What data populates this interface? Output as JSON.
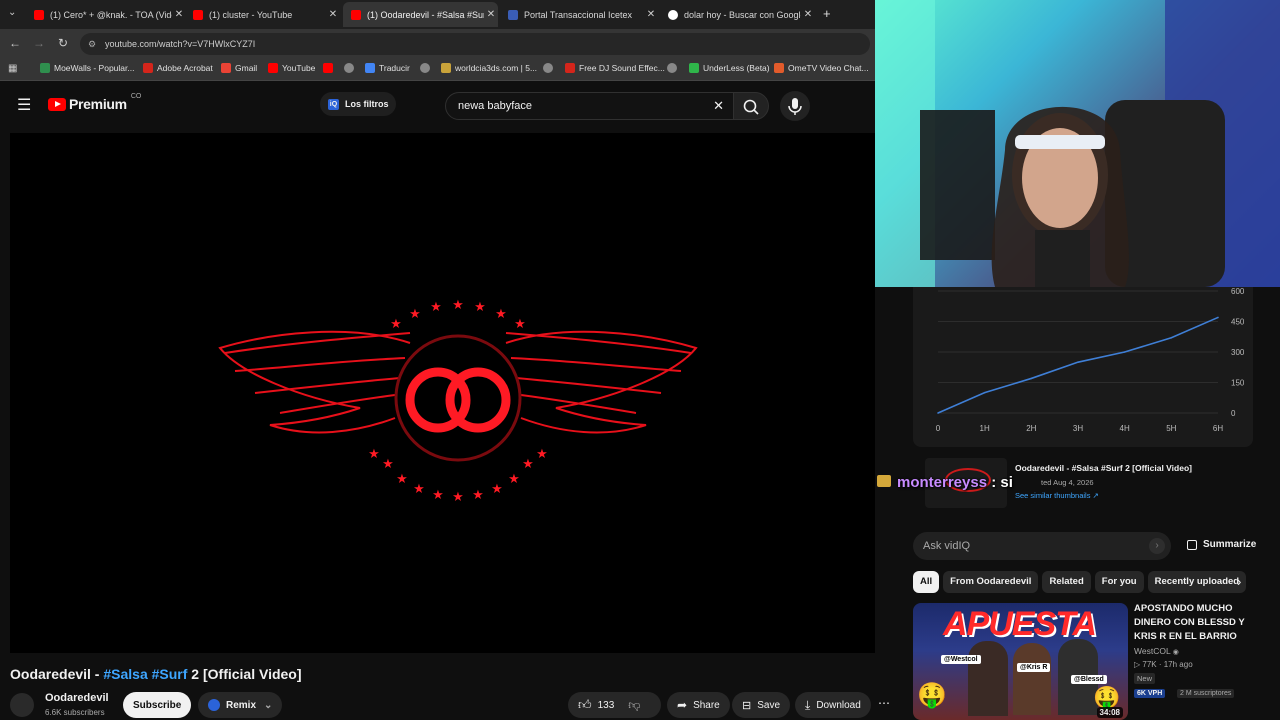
{
  "tabs": [
    {
      "title": "(1) Cero* + @knak. - TOA (Vide",
      "color": "#ff0000"
    },
    {
      "title": "(1) cluster - YouTube",
      "color": "#ff0000"
    },
    {
      "title": "(1) Oodaredevil - #Salsa #Surf 2",
      "color": "#ff0000",
      "active": true
    },
    {
      "title": "Portal Transaccional Icetex",
      "color": "#3a5db5"
    },
    {
      "title": "dolar hoy - Buscar con Google",
      "color": "#ffffff"
    }
  ],
  "address": {
    "url": "youtube.com/watch?v=V7HWlxCYZ7I"
  },
  "bookmarks": [
    {
      "label": "MoeWalls - Popular...",
      "color": "#2f8f4e"
    },
    {
      "label": "Adobe Acrobat",
      "color": "#d4251b"
    },
    {
      "label": "Gmail",
      "color": "#ea4335"
    },
    {
      "label": "YouTube",
      "color": "#ff0000"
    },
    {
      "label": "",
      "color": "#ff0000"
    },
    {
      "label": "",
      "color": "#888888"
    },
    {
      "label": "Traducir",
      "color": "#4285f4"
    },
    {
      "label": "",
      "color": "#888888"
    },
    {
      "label": "worldcia3ds.com | 5...",
      "color": "#c9a33a"
    },
    {
      "label": "",
      "color": "#888888"
    },
    {
      "label": "Free DJ Sound Effec...",
      "color": "#d4251b"
    },
    {
      "label": "",
      "color": "#888888"
    },
    {
      "label": "UnderLess (Beta)",
      "color": "#2fb54a"
    },
    {
      "label": "OmeTV Video Chat...",
      "color": "#e25b2b"
    }
  ],
  "youtube": {
    "logo_label": "Premium",
    "region": "CO",
    "filters_label": "Los filtros",
    "search_value": "newa babyface"
  },
  "video": {
    "title_prefix": "Oodaredevil - ",
    "tag1": "#Salsa",
    "tag2": "#Surf",
    "title_suffix": " 2 [Official Video]",
    "channel": "Oodaredevil",
    "subscribers": "6.6K subscribers",
    "subscribe_label": "Subscribe",
    "remix_label": "Remix",
    "likes": "133",
    "share_label": "Share",
    "save_label": "Save",
    "download_label": "Download"
  },
  "chart_data": {
    "type": "line",
    "x": [
      "0",
      "1H",
      "2H",
      "3H",
      "4H",
      "5H",
      "6H"
    ],
    "series": [
      {
        "values": [
          0,
          100,
          170,
          250,
          300,
          370,
          470
        ]
      }
    ],
    "yticks": [
      "0",
      "150",
      "300",
      "450",
      "600"
    ],
    "ylim": [
      0,
      600
    ],
    "line_color": "#3f7fd6"
  },
  "vidiq": {
    "video_title": "Oodaredevil - #Salsa #Surf 2 [Official Video]",
    "date_fragment": "ted Aug 4, 2026",
    "similar_link": "See similar thumbnails",
    "ask_placeholder": "Ask vidIQ",
    "summarize_label": "Summarize"
  },
  "chat": {
    "user": "monterreyss",
    "sep": " : ",
    "message": "si"
  },
  "chips": [
    "All",
    "From Oodaredevil",
    "Related",
    "For you",
    "Recently uploaded"
  ],
  "recommended": {
    "title": "APOSTANDO MUCHO DINERO CON BLESSD Y KRIS R EN EL BARRIO ANTIOQUI...",
    "channel": "WestCOL",
    "stats": "77K · 17h ago",
    "badge_new": "New",
    "vph": "6K VPH",
    "subs": "2 M suscriptores",
    "duration": "34:08",
    "thumb_text": "APUESTA",
    "label_westcol": "@Westcol",
    "label_krisr": "@Kris R",
    "label_blessd": "@Blessd"
  }
}
